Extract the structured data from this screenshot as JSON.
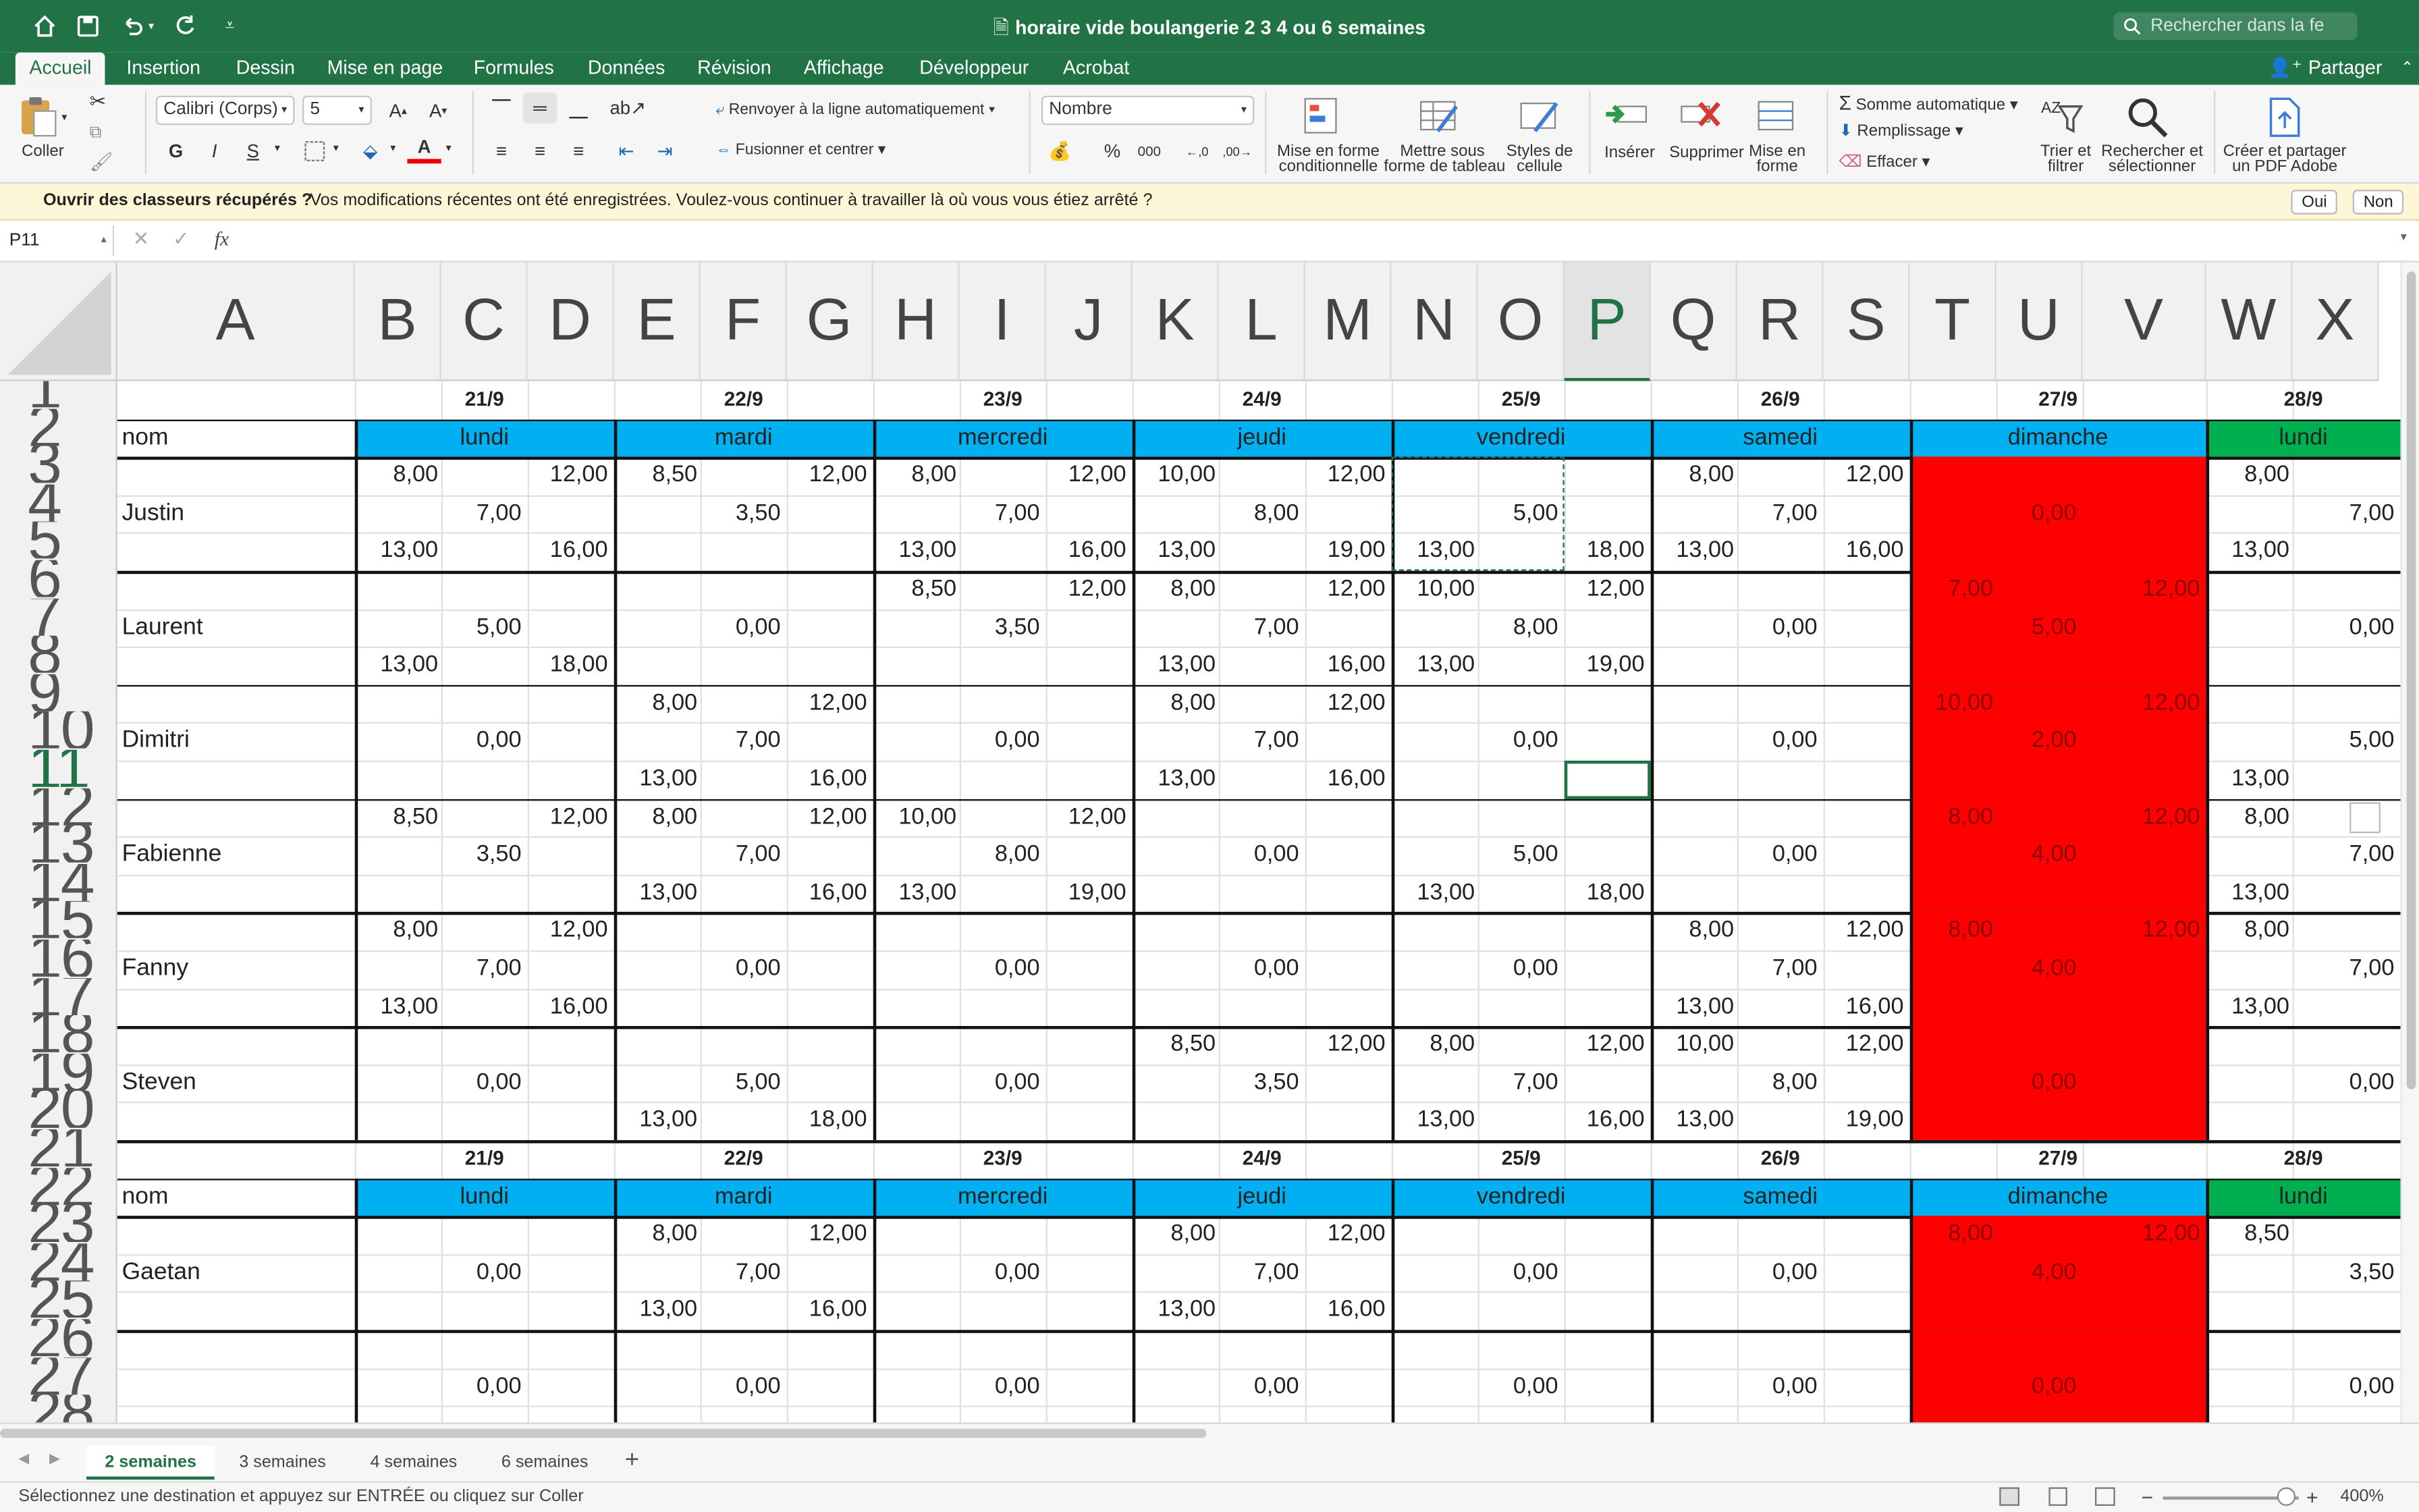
{
  "window": {
    "title": "horaire vide boulangerie 2 3 4 ou 6 semaines",
    "search_placeholder": "Rechercher dans la fe"
  },
  "ribbon_tabs": [
    "Accueil",
    "Insertion",
    "Dessin",
    "Mise en page",
    "Formules",
    "Données",
    "Révision",
    "Affichage",
    "Développeur",
    "Acrobat"
  ],
  "share_label": "Partager",
  "ribbon": {
    "paste": "Coller",
    "font_name": "Calibri (Corps)",
    "font_size": "5",
    "wrap_text": "Renvoyer à la ligne automatiquement",
    "merge_center": "Fusionner et centrer",
    "number_format": "Nombre",
    "cond_format": [
      "Mise en forme",
      "conditionnelle"
    ],
    "table_format": [
      "Mettre sous",
      "forme de tableau"
    ],
    "cell_styles": [
      "Styles de",
      "cellule"
    ],
    "insert": "Insérer",
    "delete": "Supprimer",
    "format": [
      "Mise en",
      "forme"
    ],
    "autosum": "Somme automatique",
    "fill": "Remplissage",
    "clear": "Effacer",
    "sort_filter": [
      "Trier et",
      "filtrer"
    ],
    "find_select": [
      "Rechercher et",
      "sélectionner"
    ],
    "create_pdf": [
      "Créer et partager",
      "un PDF Adobe"
    ],
    "bold": "G",
    "italic": "I",
    "underline": "S",
    "percent": "%",
    "thousands": "000"
  },
  "infobar": {
    "title": "Ouvrir des classeurs récupérés ?",
    "message": "Vos modifications récentes ont été enregistrées. Voulez-vous continuer à travailler là où vous vous étiez arrêté ?",
    "yes": "Oui",
    "no": "Non"
  },
  "formula_bar": {
    "name_box": "P11",
    "fx": "fx",
    "value": ""
  },
  "columns": [
    "A",
    "B",
    "C",
    "D",
    "E",
    "F",
    "G",
    "H",
    "I",
    "J",
    "K",
    "L",
    "M",
    "N",
    "O",
    "P",
    "Q",
    "R",
    "S",
    "T",
    "U",
    "V",
    "W",
    "X"
  ],
  "selected_column": "P",
  "row_numbers": [
    "1",
    "2",
    "3",
    "4",
    "5",
    "6",
    "7",
    "8",
    "9",
    "10",
    "11",
    "12",
    "13",
    "14",
    "15",
    "16",
    "17",
    "18",
    "19",
    "20",
    "21",
    "22",
    "23",
    "24",
    "25",
    "26",
    "27",
    "28"
  ],
  "selected_row": "11",
  "dates": [
    "21/9",
    "22/9",
    "23/9",
    "24/9",
    "25/9",
    "26/9",
    "27/9",
    "28/9"
  ],
  "days": [
    "lundi",
    "mardi",
    "mercredi",
    "jeudi",
    "vendredi",
    "samedi",
    "dimanche",
    "lundi"
  ],
  "nom_label": "nom",
  "colors": {
    "day_blue": "#00b0f0",
    "day_green": "#00b050",
    "sunday_red": "#ff0000",
    "excel_green": "#217346"
  },
  "employees_block1": [
    {
      "name": "Justin",
      "days": [
        [
          "8,00",
          "12,00",
          "7,00",
          "13,00",
          "16,00"
        ],
        [
          "8,50",
          "12,00",
          "3,50",
          "",
          ""
        ],
        [
          "8,00",
          "12,00",
          "7,00",
          "13,00",
          "16,00"
        ],
        [
          "10,00",
          "12,00",
          "8,00",
          "13,00",
          "19,00"
        ],
        [
          "",
          "",
          "5,00",
          "13,00",
          "18,00"
        ],
        [
          "8,00",
          "12,00",
          "7,00",
          "13,00",
          "16,00"
        ],
        [
          "",
          "",
          "0,00",
          "",
          ""
        ],
        [
          "8,00",
          "",
          "7,00",
          "13,00",
          ""
        ]
      ]
    },
    {
      "name": "Laurent",
      "days": [
        [
          "",
          "",
          "5,00",
          "13,00",
          "18,00"
        ],
        [
          "",
          "",
          "0,00",
          "",
          ""
        ],
        [
          "8,50",
          "12,00",
          "3,50",
          "",
          ""
        ],
        [
          "8,00",
          "12,00",
          "7,00",
          "13,00",
          "16,00"
        ],
        [
          "10,00",
          "12,00",
          "8,00",
          "13,00",
          "19,00"
        ],
        [
          "",
          "",
          "0,00",
          "",
          ""
        ],
        [
          "7,00",
          "12,00",
          "5,00",
          "",
          ""
        ],
        [
          "",
          "",
          "0,00",
          "",
          ""
        ]
      ]
    },
    {
      "name": "Dimitri",
      "days": [
        [
          "",
          "",
          "0,00",
          "",
          ""
        ],
        [
          "8,00",
          "12,00",
          "7,00",
          "13,00",
          "16,00"
        ],
        [
          "",
          "",
          "0,00",
          "",
          ""
        ],
        [
          "8,00",
          "12,00",
          "7,00",
          "13,00",
          "16,00"
        ],
        [
          "",
          "",
          "0,00",
          "",
          ""
        ],
        [
          "",
          "",
          "0,00",
          "",
          ""
        ],
        [
          "10,00",
          "12,00",
          "2,00",
          "",
          ""
        ],
        [
          "",
          "",
          "5,00",
          "13,00",
          ""
        ]
      ]
    },
    {
      "name": "Fabienne",
      "days": [
        [
          "8,50",
          "12,00",
          "3,50",
          "",
          ""
        ],
        [
          "8,00",
          "12,00",
          "7,00",
          "13,00",
          "16,00"
        ],
        [
          "10,00",
          "12,00",
          "8,00",
          "13,00",
          "19,00"
        ],
        [
          "",
          "",
          "0,00",
          "",
          ""
        ],
        [
          "",
          "",
          "5,00",
          "13,00",
          "18,00"
        ],
        [
          "",
          "",
          "0,00",
          "",
          ""
        ],
        [
          "8,00",
          "12,00",
          "4,00",
          "",
          ""
        ],
        [
          "8,00",
          "",
          "7,00",
          "13,00",
          ""
        ]
      ]
    },
    {
      "name": "Fanny",
      "days": [
        [
          "8,00",
          "12,00",
          "7,00",
          "13,00",
          "16,00"
        ],
        [
          "",
          "",
          "0,00",
          "",
          ""
        ],
        [
          "",
          "",
          "0,00",
          "",
          ""
        ],
        [
          "",
          "",
          "0,00",
          "",
          ""
        ],
        [
          "",
          "",
          "0,00",
          "",
          ""
        ],
        [
          "8,00",
          "12,00",
          "7,00",
          "13,00",
          "16,00"
        ],
        [
          "8,00",
          "12,00",
          "4,00",
          "",
          ""
        ],
        [
          "8,00",
          "",
          "7,00",
          "13,00",
          ""
        ]
      ]
    },
    {
      "name": "Steven",
      "days": [
        [
          "",
          "",
          "0,00",
          "",
          ""
        ],
        [
          "",
          "",
          "5,00",
          "13,00",
          "18,00"
        ],
        [
          "",
          "",
          "0,00",
          "",
          ""
        ],
        [
          "8,50",
          "12,00",
          "3,50",
          "",
          ""
        ],
        [
          "8,00",
          "12,00",
          "7,00",
          "13,00",
          "16,00"
        ],
        [
          "10,00",
          "12,00",
          "8,00",
          "13,00",
          "19,00"
        ],
        [
          "",
          "",
          "0,00",
          "",
          ""
        ],
        [
          "",
          "",
          "0,00",
          "",
          ""
        ]
      ]
    }
  ],
  "employees_block2": [
    {
      "name": "Gaetan",
      "days": [
        [
          "",
          "",
          "0,00",
          "",
          ""
        ],
        [
          "8,00",
          "12,00",
          "7,00",
          "13,00",
          "16,00"
        ],
        [
          "",
          "",
          "0,00",
          "",
          ""
        ],
        [
          "8,00",
          "12,00",
          "7,00",
          "13,00",
          "16,00"
        ],
        [
          "",
          "",
          "0,00",
          "",
          ""
        ],
        [
          "",
          "",
          "0,00",
          "",
          ""
        ],
        [
          "8,00",
          "12,00",
          "4,00",
          "",
          ""
        ],
        [
          "8,50",
          "",
          "3,50",
          "",
          ""
        ]
      ]
    },
    {
      "name": "",
      "days": [
        [
          "",
          "",
          "0,00",
          "",
          ""
        ],
        [
          "",
          "",
          "0,00",
          "",
          ""
        ],
        [
          "",
          "",
          "0,00",
          "",
          ""
        ],
        [
          "",
          "",
          "0,00",
          "",
          ""
        ],
        [
          "",
          "",
          "0,00",
          "",
          ""
        ],
        [
          "",
          "",
          "0,00",
          "",
          ""
        ],
        [
          "",
          "",
          "0,00",
          "",
          ""
        ],
        [
          "",
          "",
          "0,00",
          "",
          ""
        ]
      ]
    }
  ],
  "sheet_tabs": [
    "2 semaines",
    "3 semaines",
    "4 semaines",
    "6 semaines"
  ],
  "active_sheet": "2 semaines",
  "status": {
    "message": "Sélectionnez une destination et appuyez sur ENTRÉE ou cliquez sur Coller",
    "zoom": "400%"
  }
}
